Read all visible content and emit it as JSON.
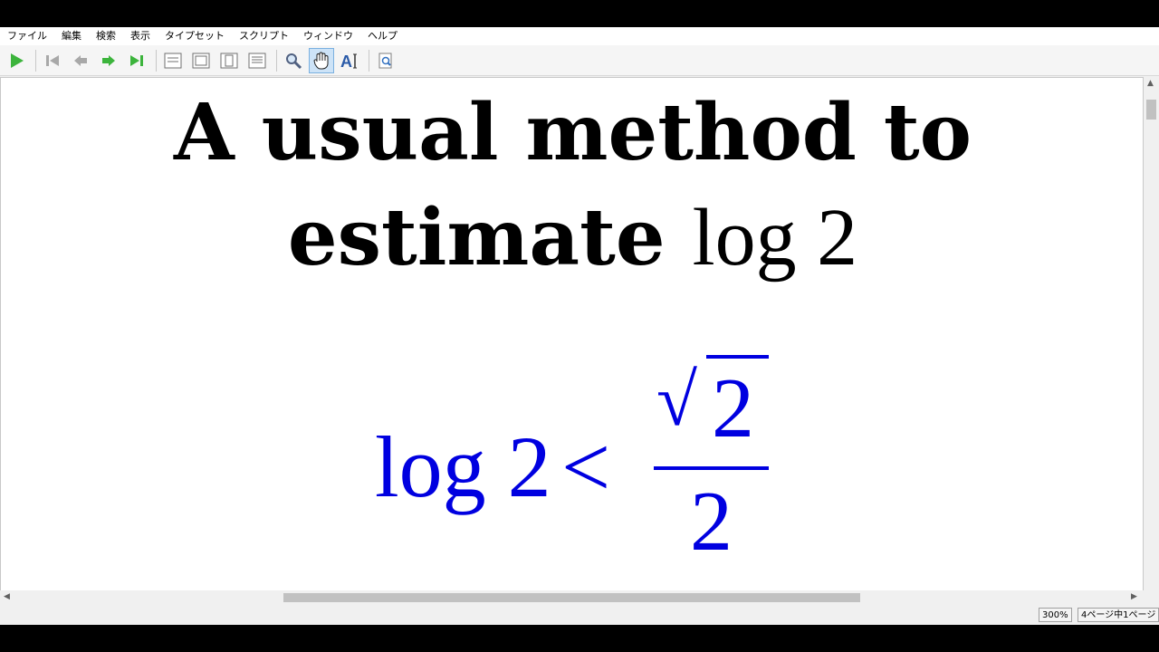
{
  "menu": [
    "ファイル",
    "編集",
    "検索",
    "表示",
    "タイプセット",
    "スクリプト",
    "ウィンドウ",
    "ヘルプ"
  ],
  "toolbar": {
    "icons": [
      "play-icon",
      "first-page-icon",
      "prev-page-icon",
      "next-page-icon",
      "last-page-icon",
      "page-layout-1-icon",
      "page-layout-2-icon",
      "page-layout-3-icon",
      "page-layout-4-icon",
      "magnifier-icon",
      "hand-tool-icon",
      "select-text-icon",
      "find-in-source-icon"
    ]
  },
  "document": {
    "title_line1": "A usual method to",
    "title_line2_word": "estimate",
    "title_line2_math": "log 2",
    "equation": {
      "lhs": "log 2",
      "relation": "<",
      "numerator_sqrt": "√",
      "numerator_arg": "2",
      "denominator": "2"
    }
  },
  "status": {
    "zoom": "300%",
    "page_info": "4ページ中1ページ"
  },
  "colors": {
    "math": "#0000e0",
    "text": "#000000"
  }
}
